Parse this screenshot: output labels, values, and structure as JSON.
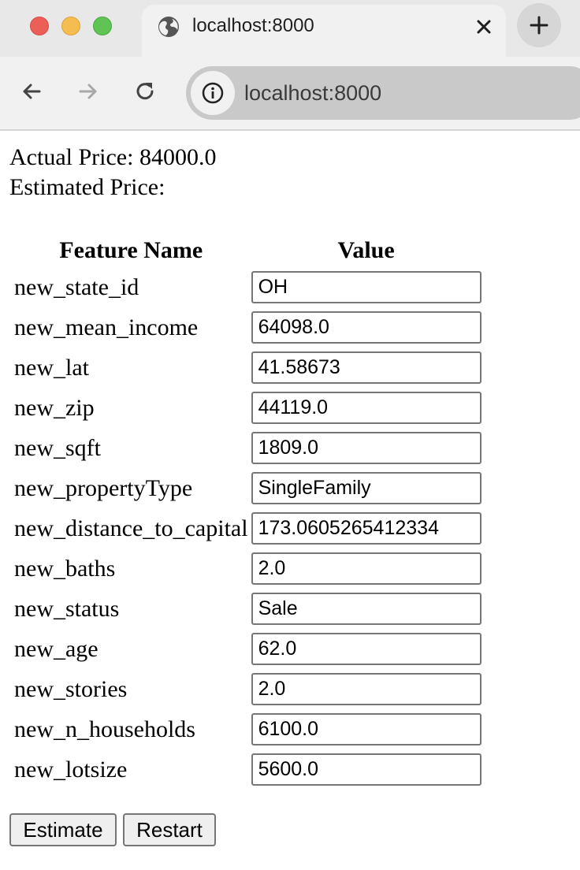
{
  "browser": {
    "tab_title": "localhost:8000",
    "url": "localhost:8000",
    "colors": {
      "close": "#ec5f57",
      "minimize": "#f5bd4f",
      "maximize": "#5fc454"
    }
  },
  "page": {
    "actual_price_label": "Actual Price: 84000.0",
    "estimated_price_label": "Estimated Price:",
    "table": {
      "headers": [
        "Feature Name",
        "Value"
      ],
      "rows": [
        {
          "name": "new_state_id",
          "value": "OH"
        },
        {
          "name": "new_mean_income",
          "value": "64098.0"
        },
        {
          "name": "new_lat",
          "value": "41.58673"
        },
        {
          "name": "new_zip",
          "value": "44119.0"
        },
        {
          "name": "new_sqft",
          "value": "1809.0"
        },
        {
          "name": "new_propertyType",
          "value": "SingleFamily"
        },
        {
          "name": "new_distance_to_capital",
          "value": "173.0605265412334"
        },
        {
          "name": "new_baths",
          "value": "2.0"
        },
        {
          "name": "new_status",
          "value": "Sale"
        },
        {
          "name": "new_age",
          "value": "62.0"
        },
        {
          "name": "new_stories",
          "value": "2.0"
        },
        {
          "name": "new_n_households",
          "value": "6100.0"
        },
        {
          "name": "new_lotsize",
          "value": "5600.0"
        }
      ]
    },
    "buttons": {
      "estimate": "Estimate",
      "restart": "Restart"
    }
  }
}
